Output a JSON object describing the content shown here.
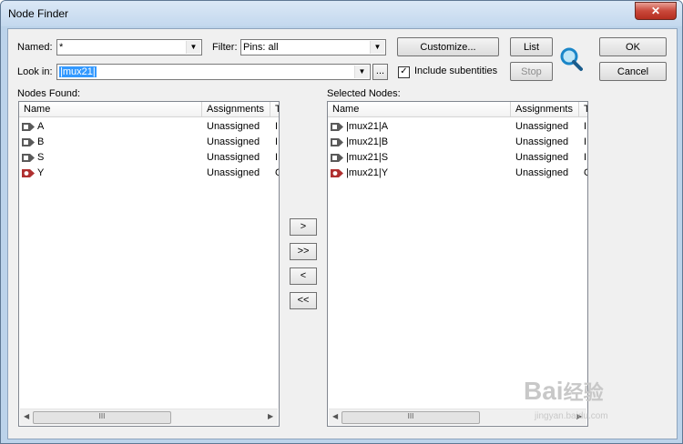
{
  "window": {
    "title": "Node Finder",
    "close_label": "✕"
  },
  "named": {
    "label": "Named:",
    "value": "*"
  },
  "filter": {
    "label": "Filter:",
    "value": "Pins: all"
  },
  "look_in": {
    "label": "Look in:",
    "value": "|mux21|"
  },
  "buttons": {
    "customize": "Customize...",
    "list": "List",
    "stop": "Stop",
    "ok": "OK",
    "cancel": "Cancel",
    "browse": "...",
    "move_one": ">",
    "move_all": ">>",
    "remove_one": "<",
    "remove_all": "<<"
  },
  "include_subentities": {
    "label": "Include subentities",
    "checked": true
  },
  "nodes_found": {
    "label": "Nodes Found:",
    "columns": [
      "Name",
      "Assignments",
      "T"
    ],
    "rows": [
      {
        "name": "A",
        "assignment": "Unassigned",
        "type": "I",
        "dir": "input"
      },
      {
        "name": "B",
        "assignment": "Unassigned",
        "type": "I",
        "dir": "input"
      },
      {
        "name": "S",
        "assignment": "Unassigned",
        "type": "I",
        "dir": "input"
      },
      {
        "name": "Y",
        "assignment": "Unassigned",
        "type": "O",
        "dir": "output"
      }
    ]
  },
  "selected_nodes": {
    "label": "Selected Nodes:",
    "columns": [
      "Name",
      "Assignments",
      "T"
    ],
    "rows": [
      {
        "name": "|mux21|A",
        "assignment": "Unassigned",
        "type": "I",
        "dir": "input"
      },
      {
        "name": "|mux21|B",
        "assignment": "Unassigned",
        "type": "I",
        "dir": "input"
      },
      {
        "name": "|mux21|S",
        "assignment": "Unassigned",
        "type": "I",
        "dir": "input"
      },
      {
        "name": "|mux21|Y",
        "assignment": "Unassigned",
        "type": "O",
        "dir": "output"
      }
    ]
  },
  "scroll_thumb_label": "III",
  "watermark": {
    "logo": "Bai",
    "brand": "经验",
    "url": "jingyan.baidu.com"
  },
  "colors": {
    "pin_input": "#5a5a5a",
    "pin_output": "#b03030",
    "selection": "#3399ff",
    "close": "#c9483a"
  },
  "icons": {
    "search": "magnifier-icon",
    "pin_input": "input-pin-icon",
    "pin_output": "output-pin-icon"
  }
}
